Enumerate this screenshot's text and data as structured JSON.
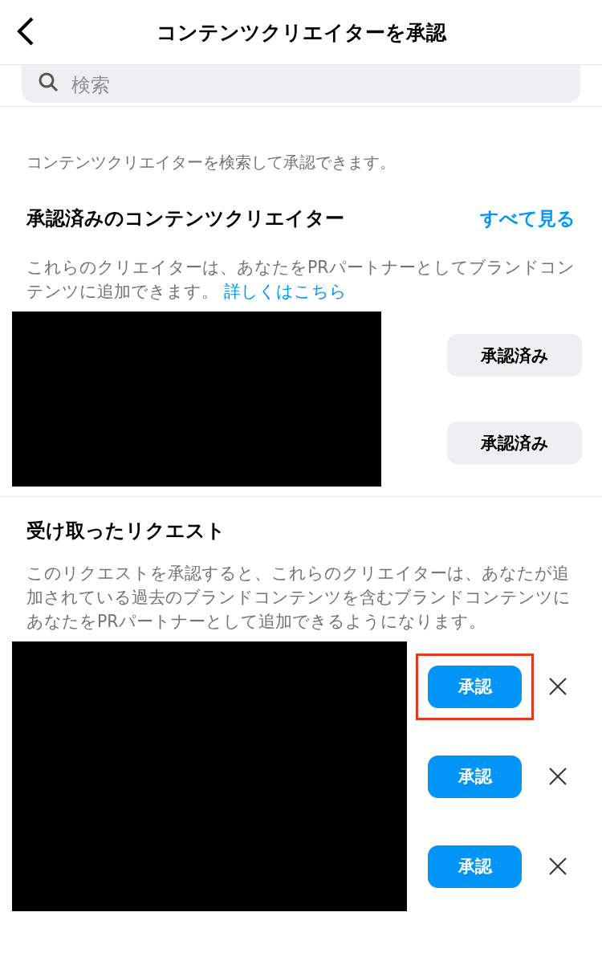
{
  "header": {
    "title": "コンテンツクリエイターを承認"
  },
  "search": {
    "placeholder": "検索"
  },
  "intro": "コンテンツクリエイターを検索して承認できます。",
  "approved": {
    "title": "承認済みのコンテンツクリエイター",
    "see_all": "すべて見る",
    "description": "これらのクリエイターは、あなたをPRパートナーとしてブランドコンテンツに追加できます。",
    "link": "詳しくはこちら",
    "items": [
      {
        "button": "承認済み"
      },
      {
        "button": "承認済み"
      }
    ]
  },
  "requests": {
    "title": "受け取ったリクエスト",
    "description": "このリクエストを承認すると、これらのクリエイターは、あなたが追加されている過去のブランドコンテンツを含むブランドコンテンツにあなたをPRパートナーとして追加できるようになります。",
    "items": [
      {
        "button": "承認",
        "highlighted": true
      },
      {
        "button": "承認",
        "highlighted": false
      },
      {
        "button": "承認",
        "highlighted": false
      }
    ]
  }
}
